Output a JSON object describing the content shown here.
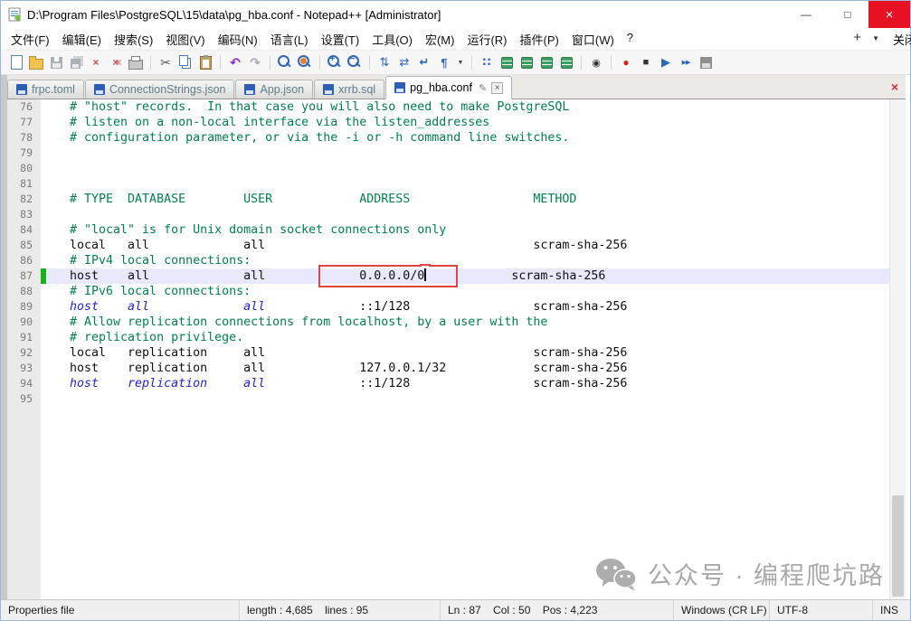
{
  "window": {
    "title": "D:\\Program Files\\PostgreSQL\\15\\data\\pg_hba.conf - Notepad++ [Administrator]",
    "controls": {
      "minimize": "—",
      "maximize": "□",
      "close": "×"
    }
  },
  "menu": {
    "items": [
      "文件(F)",
      "编辑(E)",
      "搜索(S)",
      "视图(V)",
      "编码(N)",
      "语言(L)",
      "设置(T)",
      "工具(O)",
      "宏(M)",
      "运行(R)",
      "插件(P)",
      "窗口(W)",
      "?"
    ],
    "plus": "+",
    "list_caret": "▼",
    "edge_label": "关闭"
  },
  "toolbar": {
    "icons": [
      {
        "name": "new-file-icon",
        "shape": "page"
      },
      {
        "name": "open-file-icon",
        "shape": "folder"
      },
      {
        "name": "save-icon",
        "shape": "floppy",
        "cls": "dis"
      },
      {
        "name": "save-all-icon",
        "shape": "floppy2",
        "cls": "dis"
      },
      {
        "name": "close-file-icon",
        "glyph": "×",
        "cls": "c-close"
      },
      {
        "name": "close-all-icon",
        "glyph": "×",
        "cls": "c-closeall"
      },
      {
        "name": "print-icon",
        "shape": "print"
      },
      {
        "sep": true
      },
      {
        "name": "cut-icon",
        "glyph": "✂",
        "cls": "c-cut"
      },
      {
        "name": "copy-icon",
        "shape": "copy"
      },
      {
        "name": "paste-icon",
        "shape": "paste"
      },
      {
        "sep": true
      },
      {
        "name": "undo-icon",
        "glyph": "↶",
        "cls": "c-undo"
      },
      {
        "name": "redo-icon",
        "glyph": "↷",
        "cls": "c-undo dis"
      },
      {
        "sep": true
      },
      {
        "name": "find-icon",
        "shape": "mag"
      },
      {
        "name": "replace-icon",
        "shape": "magr"
      },
      {
        "sep": true
      },
      {
        "name": "zoom-in-icon",
        "shape": "magp"
      },
      {
        "name": "zoom-out-icon",
        "shape": "magm"
      },
      {
        "sep": true
      },
      {
        "name": "sync-vertical-icon",
        "glyph": "⇅",
        "cls": "c-blue"
      },
      {
        "name": "sync-horizontal-icon",
        "glyph": "⇄",
        "cls": "c-blue"
      },
      {
        "name": "word-wrap-icon",
        "glyph": "↵",
        "cls": "c-blue c-bold"
      },
      {
        "name": "show-all-characters-icon",
        "glyph": "¶",
        "cls": "c-blue c-bold"
      },
      {
        "name": "show-symbol-dropdown-icon",
        "glyph": "▼",
        "cls": "c-drop"
      },
      {
        "sep": true
      },
      {
        "name": "indent-guide-icon",
        "glyph": "∷",
        "cls": "c-blue c-bold"
      },
      {
        "name": "function-list-icon",
        "shape": "green"
      },
      {
        "name": "document-map-icon",
        "shape": "green"
      },
      {
        "name": "document-list-icon",
        "shape": "green"
      },
      {
        "name": "folder-workspace-icon",
        "shape": "green"
      },
      {
        "sep": true
      },
      {
        "name": "monitoring-icon",
        "glyph": "◉",
        "cls": "c-dark"
      },
      {
        "sep": true
      },
      {
        "name": "record-macro-icon",
        "glyph": "●",
        "cls": "c-red"
      },
      {
        "name": "stop-macro-icon",
        "glyph": "■",
        "cls": "c-dark"
      },
      {
        "name": "play-macro-icon",
        "glyph": "▶",
        "cls": "c-blue"
      },
      {
        "name": "run-macro-multi-icon",
        "glyph": "▶▶",
        "cls": "c-multi"
      },
      {
        "name": "save-macro-icon",
        "shape": "floppyg"
      }
    ]
  },
  "tabbar": {
    "tabs": [
      {
        "label": "frpc.toml",
        "active": false
      },
      {
        "label": "ConnectionStrings.json",
        "active": false
      },
      {
        "label": "App.json",
        "active": false
      },
      {
        "label": "xrrb.sql",
        "active": false
      },
      {
        "label": "pg_hba.conf",
        "active": true
      }
    ],
    "pin_glyph": "✎",
    "close_glyph": "×",
    "corner_close": "×"
  },
  "editor": {
    "lines": [
      {
        "num": 76,
        "segs": [
          {
            "c": "comment",
            "t": "# \"host\" records.  In that case you will also need to make PostgreSQL"
          }
        ]
      },
      {
        "num": 77,
        "segs": [
          {
            "c": "comment",
            "t": "# listen on a non-local interface via the listen_addresses"
          }
        ]
      },
      {
        "num": 78,
        "segs": [
          {
            "c": "comment",
            "t": "# configuration parameter, or via the -i or -h command line switches."
          }
        ]
      },
      {
        "num": 79,
        "segs": []
      },
      {
        "num": 80,
        "segs": []
      },
      {
        "num": 81,
        "segs": []
      },
      {
        "num": 82,
        "segs": [
          {
            "c": "comment",
            "t": "# TYPE  DATABASE        USER            ADDRESS                 METHOD"
          }
        ]
      },
      {
        "num": 83,
        "segs": []
      },
      {
        "num": 84,
        "segs": [
          {
            "c": "comment",
            "t": "# \"local\" is for Unix domain socket connections only"
          }
        ]
      },
      {
        "num": 85,
        "segs": [
          {
            "c": "default",
            "t": "local   all             all                                     scram-sha-256"
          }
        ]
      },
      {
        "num": 86,
        "segs": [
          {
            "c": "comment",
            "t": "# IPv4 local connections:"
          }
        ]
      },
      {
        "num": 87,
        "current": true,
        "changed": true,
        "segs": [
          {
            "c": "default",
            "t": "host    all             all        "
          },
          {
            "box": [
              {
                "c": "default",
                "t": "     0.0.0.0/0"
              },
              {
                "caret": true
              },
              {
                "c": "default",
                "t": "    "
              }
            ]
          },
          {
            "c": "default",
            "t": "        scram-sha-256"
          }
        ]
      },
      {
        "num": 88,
        "segs": [
          {
            "c": "comment",
            "t": "# IPv6 local connections:"
          }
        ]
      },
      {
        "num": 89,
        "segs": [
          {
            "c": "key",
            "t": "host    all             all             "
          },
          {
            "c": "default",
            "t": "::1/128                 scram-sha-256"
          }
        ]
      },
      {
        "num": 90,
        "segs": [
          {
            "c": "comment",
            "t": "# Allow replication connections from localhost, by a user with the"
          }
        ]
      },
      {
        "num": 91,
        "segs": [
          {
            "c": "comment",
            "t": "# replication privilege."
          }
        ]
      },
      {
        "num": 92,
        "segs": [
          {
            "c": "default",
            "t": "local   replication     all                                     scram-sha-256"
          }
        ]
      },
      {
        "num": 93,
        "segs": [
          {
            "c": "default",
            "t": "host    replication     all             127.0.0.1/32            scram-sha-256"
          }
        ]
      },
      {
        "num": 94,
        "segs": [
          {
            "c": "key",
            "t": "host    replication     all             "
          },
          {
            "c": "default",
            "t": "::1/128                 scram-sha-256"
          }
        ]
      },
      {
        "num": 95,
        "segs": []
      }
    ]
  },
  "statusbar": {
    "doc_type": "Properties file",
    "length_info": "length : 4,685    lines : 95",
    "caret_info": "Ln : 87    Col : 50    Pos : 4,223",
    "eol": "Windows (CR LF)",
    "encoding": "UTF-8",
    "insert_mode": "INS"
  },
  "watermark": {
    "text": "公众号 · 编程爬坑路"
  },
  "colors": {
    "annotation_red": "#df4545",
    "current_line_bg": "#e8e8ff",
    "comment_green": "#00804d",
    "key_blue": "#2222cc",
    "change_marker_green": "#17b317",
    "close_button_red": "#e81123"
  }
}
